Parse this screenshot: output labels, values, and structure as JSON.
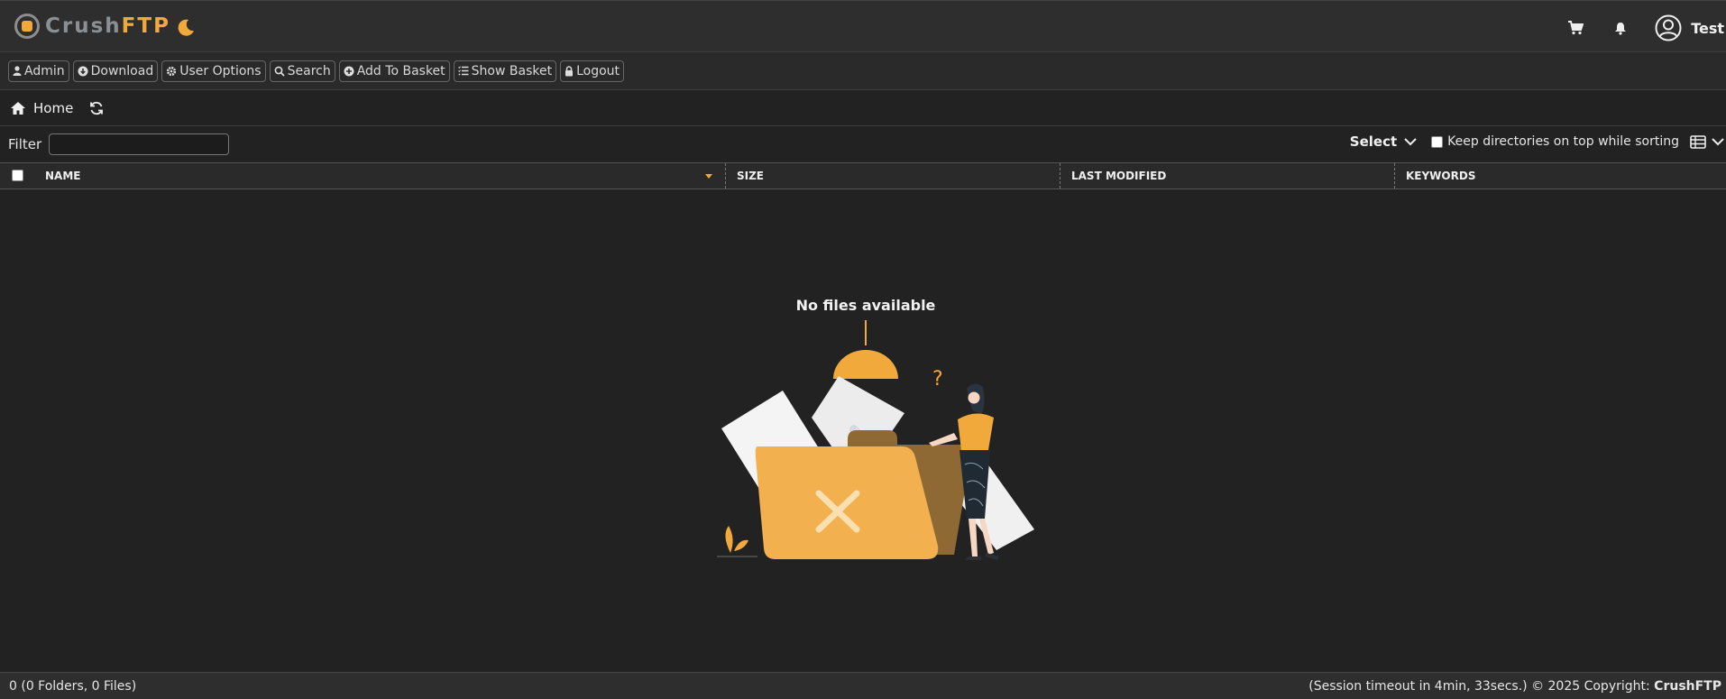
{
  "header": {
    "logo_text_a": "Crush",
    "logo_text_b": "FTP",
    "user_name": "Test",
    "brand_color": "#f2a93b"
  },
  "toolbar": {
    "buttons": [
      {
        "label": "Admin",
        "icon": "user-icon"
      },
      {
        "label": "Download",
        "icon": "download-icon"
      },
      {
        "label": "User Options",
        "icon": "gear-icon"
      },
      {
        "label": "Search",
        "icon": "search-icon"
      },
      {
        "label": "Add To Basket",
        "icon": "add-circle-icon"
      },
      {
        "label": "Show Basket",
        "icon": "list-icon"
      },
      {
        "label": "Logout",
        "icon": "lock-icon"
      }
    ]
  },
  "breadcrumb": {
    "home_label": "Home"
  },
  "filter": {
    "label": "Filter",
    "value": "",
    "placeholder": ""
  },
  "options": {
    "select_label": "Select",
    "keep_dirs_label": "Keep directories on top while sorting",
    "keep_dirs_checked": false
  },
  "table": {
    "columns": [
      "NAME",
      "SIZE",
      "LAST MODIFIED",
      "KEYWORDS"
    ],
    "sort_column": "NAME",
    "rows": []
  },
  "empty_state": {
    "title": "No files available"
  },
  "status": {
    "count_text": "0 (0 Folders, 0 Files)",
    "session_text": "(Session timeout in 4min, 33secs.) © 2025 Copyright: ",
    "brand": "CrushFTP"
  }
}
